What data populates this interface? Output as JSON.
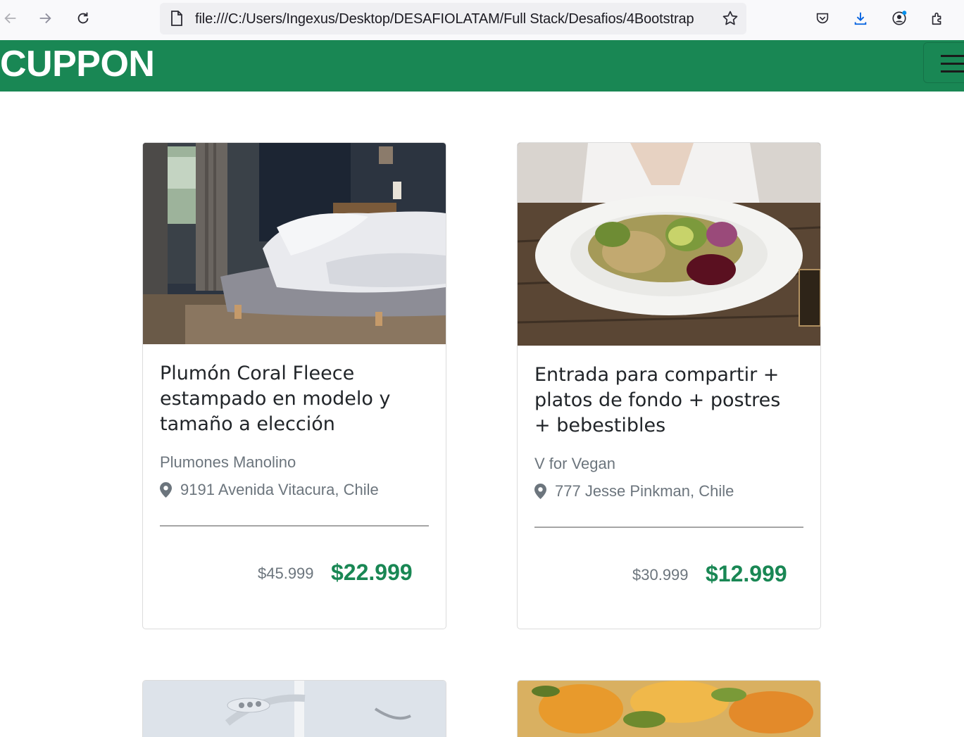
{
  "browser": {
    "url": "file:///C:/Users/Ingexus/Desktop/DESAFIOLATAM/Full Stack/Desafios/4Bootstrap"
  },
  "navbar": {
    "brand": "CUPPON",
    "bg_color": "#198754"
  },
  "cards": [
    {
      "title": "Plumón Coral Fleece estampado en modelo y tamaño a elección",
      "merchant": "Plumones Manolino",
      "address": "9191 Avenida Vitacura, Chile",
      "old_price": "$45.999",
      "new_price": "$22.999",
      "image": "bedroom-bed-photo"
    },
    {
      "title": "Entrada para compartir + platos de fondo + postres + bebestibles",
      "merchant": "V for Vegan",
      "address": "777 Jesse Pinkman, Chile",
      "old_price": "$30.999",
      "new_price": "$12.999",
      "image": "vegan-salad-bowl-photo"
    }
  ],
  "colors": {
    "accent_green": "#198754",
    "muted_text": "#6c757d"
  }
}
